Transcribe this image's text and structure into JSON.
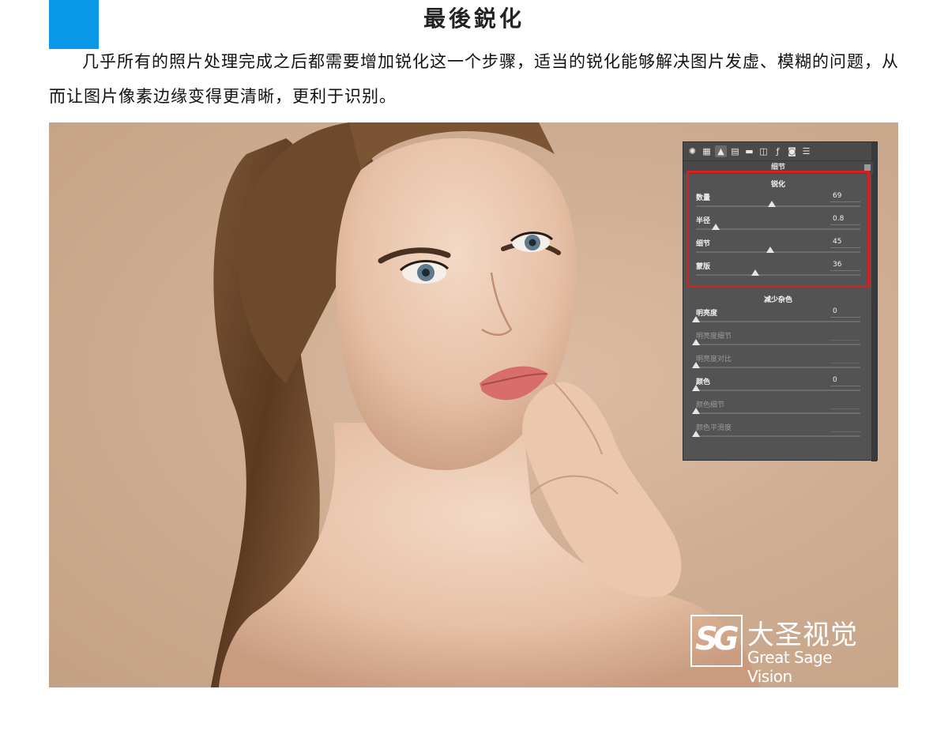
{
  "page": {
    "title": "最後鋭化",
    "intro": "几乎所有的照片处理完成之后都需要增加锐化这一个步骤，适当的锐化能够解决图片发虚、模糊的问题，从而让图片像素边缘变得更清晰，更利于识别。"
  },
  "colors": {
    "accent": "#0a98e8",
    "highlight": "#d61f1f",
    "panel_bg": "#535353"
  },
  "panel": {
    "header": "细节",
    "toolbar_icons": [
      "aperture-icon",
      "grid-icon",
      "mountains-icon",
      "split-tone-icon",
      "hsl-icon",
      "lens-icon",
      "fx-icon",
      "camera-icon",
      "sliders-icon"
    ],
    "sharpen": {
      "title": "锐化",
      "sliders": [
        {
          "label": "数量",
          "value": "69",
          "level": 0.46
        },
        {
          "label": "半径",
          "value": "0.8",
          "level": 0.12
        },
        {
          "label": "细节",
          "value": "45",
          "level": 0.45
        },
        {
          "label": "蒙版",
          "value": "36",
          "level": 0.36
        }
      ]
    },
    "noise": {
      "title": "减少杂色",
      "sliders": [
        {
          "label": "明亮度",
          "value": "0",
          "level": 0,
          "enabled": true
        },
        {
          "label": "明亮度细节",
          "value": "",
          "level": 0,
          "enabled": false
        },
        {
          "label": "明亮度对比",
          "value": "",
          "level": 0,
          "enabled": false
        },
        {
          "label": "颜色",
          "value": "0",
          "level": 0,
          "enabled": true
        },
        {
          "label": "颜色细节",
          "value": "",
          "level": 0,
          "enabled": false
        },
        {
          "label": "颜色平滑度",
          "value": "",
          "level": 0,
          "enabled": false
        }
      ]
    }
  },
  "watermark": {
    "logo": "SG",
    "cn": "大圣视觉",
    "en": "Great Sage Vision"
  }
}
